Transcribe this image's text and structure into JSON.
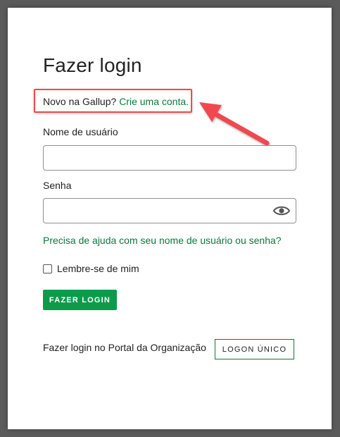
{
  "login": {
    "title": "Fazer login",
    "new_prefix": "Novo na Gallup?",
    "create_account_link": "Crie uma conta.",
    "username_label": "Nome de usuário",
    "username_value": "",
    "password_label": "Senha",
    "password_value": "",
    "help_link": "Precisa de ajuda com seu nome de usuário ou senha?",
    "remember_label": "Lembre-se de mim",
    "remember_checked": false,
    "login_button": "FAZER LOGIN",
    "portal_text": "Fazer login no Portal da Organização",
    "sso_button": "LOGON ÚNICO"
  },
  "icons": {
    "password_toggle": "eye-icon",
    "annotation": "arrow-icon"
  },
  "colors": {
    "brand_green": "#0c9b4b",
    "link_green": "#0a7a3b",
    "annotation_red": "#ef4a4f"
  }
}
